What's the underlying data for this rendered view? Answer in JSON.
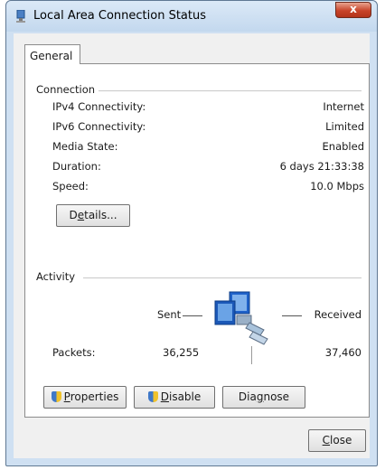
{
  "window": {
    "title": "Local Area Connection Status",
    "close_glyph": "x"
  },
  "tabs": [
    {
      "label": "General"
    }
  ],
  "connection": {
    "group_label": "Connection",
    "rows": [
      {
        "label": "IPv4 Connectivity:",
        "value": "Internet"
      },
      {
        "label": "IPv6 Connectivity:",
        "value": "Limited"
      },
      {
        "label": "Media State:",
        "value": "Enabled"
      },
      {
        "label": "Duration:",
        "value": "6 days 21:33:38"
      },
      {
        "label": "Speed:",
        "value": "10.0 Mbps"
      }
    ],
    "details_button": {
      "pre": "D",
      "underlined": "e",
      "post": "tails..."
    }
  },
  "activity": {
    "group_label": "Activity",
    "sent_label": "Sent",
    "received_label": "Received",
    "packets_label": "Packets:",
    "packets_sent": "36,255",
    "packets_received": "37,460",
    "icon": "network-computers-icon"
  },
  "buttons": {
    "properties": {
      "underlined": "P",
      "post": "roperties"
    },
    "disable": {
      "underlined": "D",
      "post": "isable"
    },
    "diagnose": {
      "pre": "Dia",
      "underlined": "g",
      "post": "nose"
    },
    "close": {
      "underlined": "C",
      "post": "lose"
    }
  },
  "colors": {
    "title_bar": "#c3d8ee",
    "close_button": "#c8442a",
    "frame": "#cfe0f2"
  }
}
